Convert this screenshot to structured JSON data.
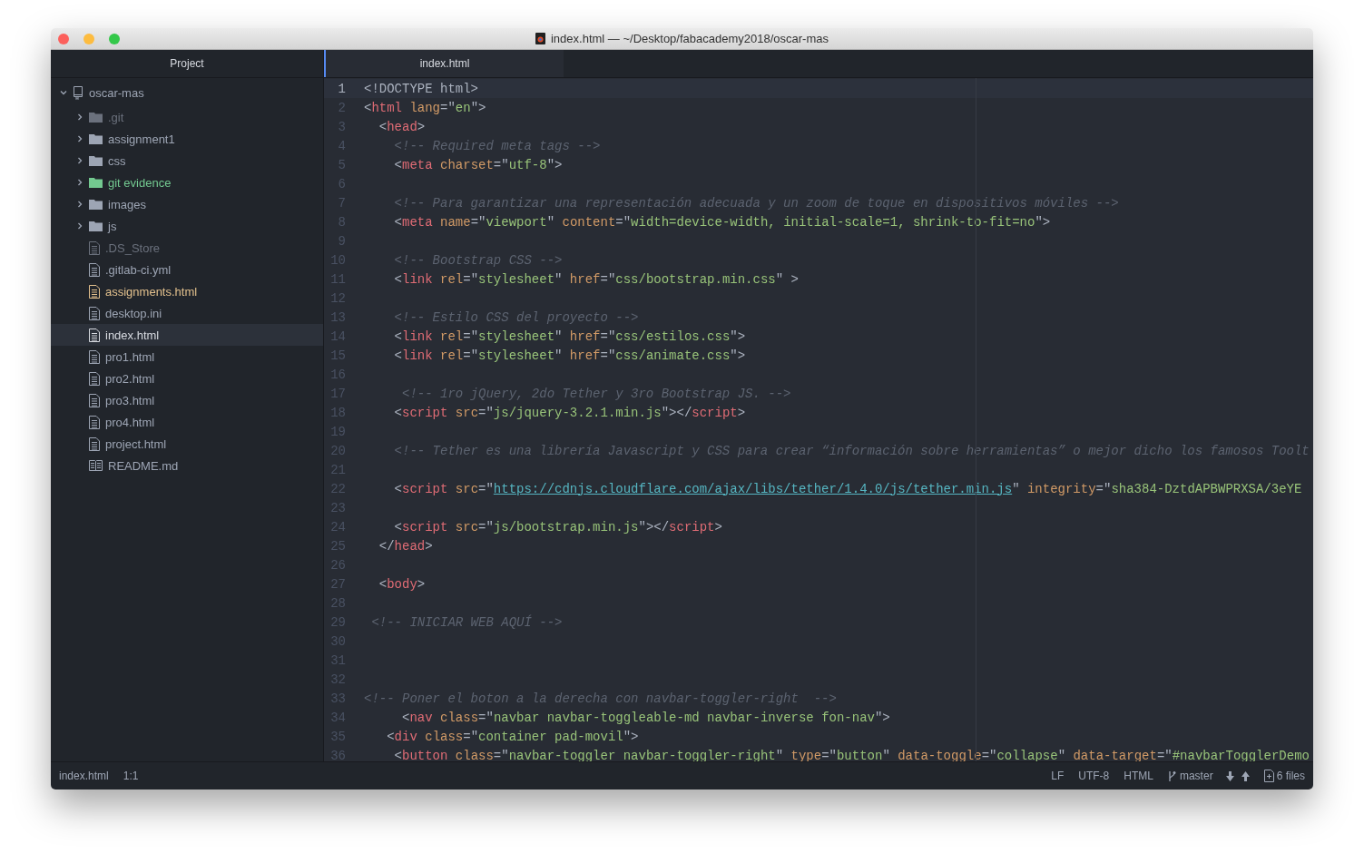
{
  "window": {
    "title": "index.html — ~/Desktop/fabacademy2018/oscar-mas"
  },
  "sidebar": {
    "title": "Project",
    "tree": [
      {
        "name": "oscar-mas",
        "kind": "repo",
        "color": "#9da5b4",
        "selected": false,
        "expanded": true,
        "children": [
          {
            "name": ".git",
            "kind": "folder",
            "color": "#6b717d",
            "selected": false,
            "expanded": false
          },
          {
            "name": "assignment1",
            "kind": "folder",
            "color": "#9da5b4",
            "selected": false,
            "expanded": false
          },
          {
            "name": "css",
            "kind": "folder",
            "color": "#9da5b4",
            "selected": false,
            "expanded": false
          },
          {
            "name": "git evidence",
            "kind": "folder",
            "color": "#73c990",
            "selected": false,
            "expanded": false
          },
          {
            "name": "images",
            "kind": "folder",
            "color": "#9da5b4",
            "selected": false,
            "expanded": false
          },
          {
            "name": "js",
            "kind": "folder",
            "color": "#9da5b4",
            "selected": false,
            "expanded": false
          },
          {
            "name": ".DS_Store",
            "kind": "file",
            "color": "#6b717d",
            "selected": false
          },
          {
            "name": ".gitlab-ci.yml",
            "kind": "file",
            "color": "#9da5b4",
            "selected": false
          },
          {
            "name": "assignments.html",
            "kind": "file",
            "color": "#e2c08d",
            "selected": false
          },
          {
            "name": "desktop.ini",
            "kind": "file",
            "color": "#9da5b4",
            "selected": false
          },
          {
            "name": "index.html",
            "kind": "file",
            "color": "#d7dae0",
            "selected": true
          },
          {
            "name": "pro1.html",
            "kind": "file",
            "color": "#9da5b4",
            "selected": false
          },
          {
            "name": "pro2.html",
            "kind": "file",
            "color": "#9da5b4",
            "selected": false
          },
          {
            "name": "pro3.html",
            "kind": "file",
            "color": "#9da5b4",
            "selected": false
          },
          {
            "name": "pro4.html",
            "kind": "file",
            "color": "#9da5b4",
            "selected": false
          },
          {
            "name": "project.html",
            "kind": "file",
            "color": "#9da5b4",
            "selected": false
          },
          {
            "name": "README.md",
            "kind": "markdown",
            "color": "#9da5b4",
            "selected": false
          }
        ]
      }
    ]
  },
  "tabs": [
    {
      "label": "index.html",
      "selected": true
    }
  ],
  "editor": {
    "lines": [
      {
        "number": "1",
        "active": true,
        "tokens": [
          {
            "kind": "punct",
            "text": "<!DOCTYPE html>"
          }
        ]
      },
      {
        "number": "2",
        "active": false,
        "tokens": [
          {
            "kind": "punct",
            "text": "<"
          },
          {
            "kind": "tag",
            "text": "html"
          },
          {
            "kind": "attr",
            "text": " lang"
          },
          {
            "kind": "punct",
            "text": "=\""
          },
          {
            "kind": "string",
            "text": "en"
          },
          {
            "kind": "punct",
            "text": "\">"
          }
        ]
      },
      {
        "number": "3",
        "active": false,
        "tokens": [
          {
            "kind": "punct",
            "text": "  <"
          },
          {
            "kind": "tag",
            "text": "head"
          },
          {
            "kind": "punct",
            "text": ">"
          }
        ]
      },
      {
        "number": "4",
        "active": false,
        "tokens": [
          {
            "kind": "comment",
            "text": "    <!-- Required meta tags -->"
          }
        ]
      },
      {
        "number": "5",
        "active": false,
        "tokens": [
          {
            "kind": "punct",
            "text": "    <"
          },
          {
            "kind": "tag",
            "text": "meta"
          },
          {
            "kind": "attr",
            "text": " charset"
          },
          {
            "kind": "punct",
            "text": "=\""
          },
          {
            "kind": "string",
            "text": "utf-8"
          },
          {
            "kind": "punct",
            "text": "\">"
          }
        ]
      },
      {
        "number": "6",
        "active": false
      },
      {
        "number": "7",
        "active": false,
        "tokens": [
          {
            "kind": "comment",
            "text": "    <!-- Para garantizar una representación adecuada y un zoom de toque en dispositivos móviles -->"
          }
        ]
      },
      {
        "number": "8",
        "active": false,
        "tokens": [
          {
            "kind": "punct",
            "text": "    <"
          },
          {
            "kind": "tag",
            "text": "meta"
          },
          {
            "kind": "attr",
            "text": " name"
          },
          {
            "kind": "punct",
            "text": "=\""
          },
          {
            "kind": "string",
            "text": "viewport"
          },
          {
            "kind": "punct",
            "text": "\""
          },
          {
            "kind": "attr",
            "text": " content"
          },
          {
            "kind": "punct",
            "text": "=\""
          },
          {
            "kind": "string",
            "text": "width=device-width, initial-scale=1, shrink-to-fit=no"
          },
          {
            "kind": "punct",
            "text": "\">"
          }
        ]
      },
      {
        "number": "9",
        "active": false
      },
      {
        "number": "10",
        "active": false,
        "tokens": [
          {
            "kind": "comment",
            "text": "    <!-- Bootstrap CSS -->"
          }
        ]
      },
      {
        "number": "11",
        "active": false,
        "tokens": [
          {
            "kind": "punct",
            "text": "    <"
          },
          {
            "kind": "tag",
            "text": "link"
          },
          {
            "kind": "attr",
            "text": " rel"
          },
          {
            "kind": "punct",
            "text": "=\""
          },
          {
            "kind": "string",
            "text": "stylesheet"
          },
          {
            "kind": "punct",
            "text": "\""
          },
          {
            "kind": "attr",
            "text": " href"
          },
          {
            "kind": "punct",
            "text": "=\""
          },
          {
            "kind": "string",
            "text": "css/bootstrap.min.css"
          },
          {
            "kind": "punct",
            "text": "\" >"
          }
        ]
      },
      {
        "number": "12",
        "active": false
      },
      {
        "number": "13",
        "active": false,
        "tokens": [
          {
            "kind": "comment",
            "text": "    <!-- Estilo CSS del proyecto -->"
          }
        ]
      },
      {
        "number": "14",
        "active": false,
        "tokens": [
          {
            "kind": "punct",
            "text": "    <"
          },
          {
            "kind": "tag",
            "text": "link"
          },
          {
            "kind": "attr",
            "text": " rel"
          },
          {
            "kind": "punct",
            "text": "=\""
          },
          {
            "kind": "string",
            "text": "stylesheet"
          },
          {
            "kind": "punct",
            "text": "\""
          },
          {
            "kind": "attr",
            "text": " href"
          },
          {
            "kind": "punct",
            "text": "=\""
          },
          {
            "kind": "string",
            "text": "css/estilos.css"
          },
          {
            "kind": "punct",
            "text": "\">"
          }
        ]
      },
      {
        "number": "15",
        "active": false,
        "tokens": [
          {
            "kind": "punct",
            "text": "    <"
          },
          {
            "kind": "tag",
            "text": "link"
          },
          {
            "kind": "attr",
            "text": " rel"
          },
          {
            "kind": "punct",
            "text": "=\""
          },
          {
            "kind": "string",
            "text": "stylesheet"
          },
          {
            "kind": "punct",
            "text": "\""
          },
          {
            "kind": "attr",
            "text": " href"
          },
          {
            "kind": "punct",
            "text": "=\""
          },
          {
            "kind": "string",
            "text": "css/animate.css"
          },
          {
            "kind": "punct",
            "text": "\">"
          }
        ]
      },
      {
        "number": "16",
        "active": false
      },
      {
        "number": "17",
        "active": false,
        "tokens": [
          {
            "kind": "comment",
            "text": "     <!-- 1ro jQuery, 2do Tether y 3ro Bootstrap JS. -->"
          }
        ]
      },
      {
        "number": "18",
        "active": false,
        "tokens": [
          {
            "kind": "punct",
            "text": "    <"
          },
          {
            "kind": "tag",
            "text": "script"
          },
          {
            "kind": "attr",
            "text": " src"
          },
          {
            "kind": "punct",
            "text": "=\""
          },
          {
            "kind": "string",
            "text": "js/jquery-3.2.1.min.js"
          },
          {
            "kind": "punct",
            "text": "\"></"
          },
          {
            "kind": "tag",
            "text": "script"
          },
          {
            "kind": "punct",
            "text": ">"
          }
        ]
      },
      {
        "number": "19",
        "active": false
      },
      {
        "number": "20",
        "active": false,
        "tokens": [
          {
            "kind": "comment",
            "text": "    <!-- Tether es una librería Javascript y CSS para crear “información sobre herramientas” o mejor dicho los famosos Toolt"
          }
        ]
      },
      {
        "number": "21",
        "active": false
      },
      {
        "number": "22",
        "active": false,
        "tokens": [
          {
            "kind": "punct",
            "text": "    <"
          },
          {
            "kind": "tag",
            "text": "script"
          },
          {
            "kind": "attr",
            "text": " src"
          },
          {
            "kind": "punct",
            "text": "=\""
          },
          {
            "kind": "link",
            "text": "https://cdnjs.cloudflare.com/ajax/libs/tether/1.4.0/js/tether.min.js"
          },
          {
            "kind": "punct",
            "text": "\""
          },
          {
            "kind": "attr",
            "text": " integrity"
          },
          {
            "kind": "punct",
            "text": "=\""
          },
          {
            "kind": "string",
            "text": "sha384-DztdAPBWPRXSA/3eYE"
          }
        ]
      },
      {
        "number": "23",
        "active": false
      },
      {
        "number": "24",
        "active": false,
        "tokens": [
          {
            "kind": "punct",
            "text": "    <"
          },
          {
            "kind": "tag",
            "text": "script"
          },
          {
            "kind": "attr",
            "text": " src"
          },
          {
            "kind": "punct",
            "text": "=\""
          },
          {
            "kind": "string",
            "text": "js/bootstrap.min.js"
          },
          {
            "kind": "punct",
            "text": "\"></"
          },
          {
            "kind": "tag",
            "text": "script"
          },
          {
            "kind": "punct",
            "text": ">"
          }
        ]
      },
      {
        "number": "25",
        "active": false,
        "tokens": [
          {
            "kind": "punct",
            "text": "  </"
          },
          {
            "kind": "tag",
            "text": "head"
          },
          {
            "kind": "punct",
            "text": ">"
          }
        ]
      },
      {
        "number": "26",
        "active": false
      },
      {
        "number": "27",
        "active": false,
        "tokens": [
          {
            "kind": "punct",
            "text": "  <"
          },
          {
            "kind": "tag",
            "text": "body"
          },
          {
            "kind": "punct",
            "text": ">"
          }
        ]
      },
      {
        "number": "28",
        "active": false
      },
      {
        "number": "29",
        "active": false,
        "tokens": [
          {
            "kind": "comment",
            "text": " <!-- INICIAR WEB AQUÍ -->"
          }
        ]
      },
      {
        "number": "30",
        "active": false
      },
      {
        "number": "31",
        "active": false
      },
      {
        "number": "32",
        "active": false
      },
      {
        "number": "33",
        "active": false,
        "tokens": [
          {
            "kind": "comment",
            "text": "<!-- Poner el boton a la derecha con navbar-toggler-right  -->"
          }
        ]
      },
      {
        "number": "34",
        "active": false,
        "tokens": [
          {
            "kind": "punct",
            "text": "     <"
          },
          {
            "kind": "tag",
            "text": "nav"
          },
          {
            "kind": "attr",
            "text": " class"
          },
          {
            "kind": "punct",
            "text": "=\""
          },
          {
            "kind": "string",
            "text": "navbar navbar-toggleable-md navbar-inverse fon-nav"
          },
          {
            "kind": "punct",
            "text": "\">"
          }
        ]
      },
      {
        "number": "35",
        "active": false,
        "tokens": [
          {
            "kind": "punct",
            "text": "   <"
          },
          {
            "kind": "tag",
            "text": "div"
          },
          {
            "kind": "attr",
            "text": " class"
          },
          {
            "kind": "punct",
            "text": "=\""
          },
          {
            "kind": "string",
            "text": "container pad-movil"
          },
          {
            "kind": "punct",
            "text": "\">"
          }
        ]
      },
      {
        "number": "36",
        "active": false,
        "tokens": [
          {
            "kind": "punct",
            "text": "    <"
          },
          {
            "kind": "tag",
            "text": "button"
          },
          {
            "kind": "attr",
            "text": " class"
          },
          {
            "kind": "punct",
            "text": "=\""
          },
          {
            "kind": "string",
            "text": "navbar-toggler navbar-toggler-right"
          },
          {
            "kind": "punct",
            "text": "\""
          },
          {
            "kind": "attr",
            "text": " type"
          },
          {
            "kind": "punct",
            "text": "=\""
          },
          {
            "kind": "string",
            "text": "button"
          },
          {
            "kind": "punct",
            "text": "\""
          },
          {
            "kind": "attr",
            "text": " data-toggle"
          },
          {
            "kind": "punct",
            "text": "=\""
          },
          {
            "kind": "string",
            "text": "collapse"
          },
          {
            "kind": "punct",
            "text": "\""
          },
          {
            "kind": "attr",
            "text": " data-target"
          },
          {
            "kind": "punct",
            "text": "=\""
          },
          {
            "kind": "string",
            "text": "#navbarTogglerDemo"
          }
        ]
      }
    ]
  },
  "status_bar": {
    "file": "index.html",
    "cursor": "1:1",
    "line_ending": "LF",
    "encoding": "UTF-8",
    "grammar": "HTML",
    "branch": "master",
    "changes": "6 files"
  }
}
